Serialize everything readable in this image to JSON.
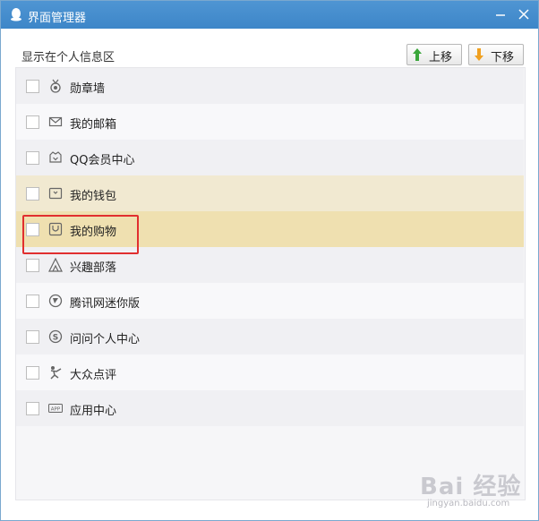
{
  "window": {
    "title": "界面管理器",
    "colors": {
      "titlebar": "#3d86c8",
      "selected_row": "#efe0b0",
      "hover_row": "#f1e9d1",
      "highlight_border": "#e12f2f"
    }
  },
  "section": {
    "label": "显示在个人信息区"
  },
  "toolbar": {
    "move_up_label": "上移",
    "move_down_label": "下移"
  },
  "items": [
    {
      "label": "勋章墙",
      "icon": "medal-icon",
      "checked": false
    },
    {
      "label": "我的邮箱",
      "icon": "mail-icon",
      "checked": false
    },
    {
      "label": "QQ会员中心",
      "icon": "vip-crown-icon",
      "checked": false
    },
    {
      "label": "我的钱包",
      "icon": "wallet-icon",
      "checked": false
    },
    {
      "label": "我的购物",
      "icon": "shopping-bag-icon",
      "checked": false
    },
    {
      "label": "兴趣部落",
      "icon": "tent-icon",
      "checked": false
    },
    {
      "label": "腾讯网迷你版",
      "icon": "tencent-news-icon",
      "checked": false
    },
    {
      "label": "问问个人中心",
      "icon": "soso-icon",
      "checked": false
    },
    {
      "label": "大众点评",
      "icon": "dianping-icon",
      "checked": false
    },
    {
      "label": "应用中心",
      "icon": "app-icon",
      "checked": false
    }
  ],
  "watermark": {
    "text": "Bai 经验",
    "sub": "jingyan.baidu.com"
  }
}
